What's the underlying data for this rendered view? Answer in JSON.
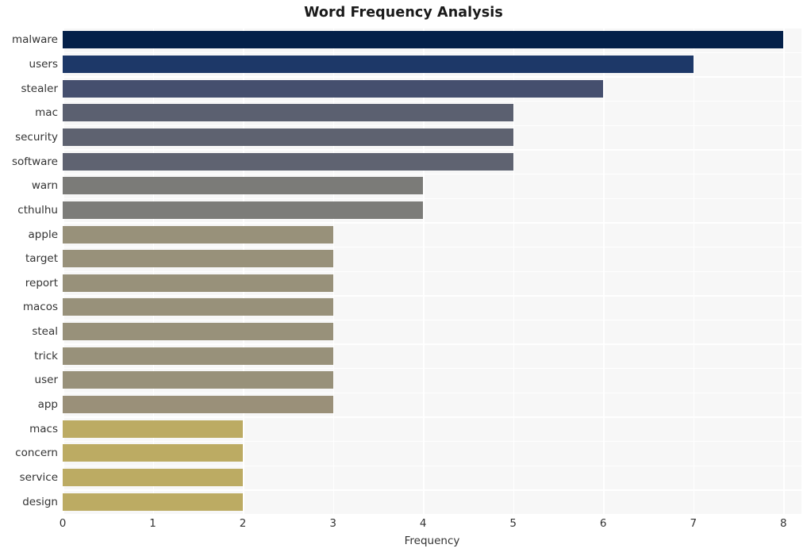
{
  "chart_data": {
    "type": "bar",
    "orientation": "horizontal",
    "title": "Word Frequency Analysis",
    "xlabel": "Frequency",
    "ylabel": "",
    "xlim": [
      0,
      8.2
    ],
    "xticks": [
      "0",
      "1",
      "2",
      "3",
      "4",
      "5",
      "6",
      "7",
      "8"
    ],
    "xtick_values": [
      0,
      1,
      2,
      3,
      4,
      5,
      6,
      7,
      8
    ],
    "grid": true,
    "legend": null,
    "categories": [
      "malware",
      "users",
      "stealer",
      "mac",
      "security",
      "software",
      "warn",
      "cthulhu",
      "apple",
      "target",
      "report",
      "macos",
      "steal",
      "trick",
      "user",
      "app",
      "macs",
      "concern",
      "service",
      "design"
    ],
    "values": [
      8,
      7,
      6,
      5,
      5,
      5,
      4,
      4,
      3,
      3,
      3,
      3,
      3,
      3,
      3,
      3,
      2,
      2,
      2,
      2
    ],
    "bar_colors": [
      "#042049",
      "#1d3868",
      "#454f6e",
      "#5b6070",
      "#5e6270",
      "#5f6371",
      "#7b7b78",
      "#7c7c79",
      "#98917a",
      "#98917a",
      "#98917a",
      "#98917a",
      "#98917a",
      "#98917a",
      "#98917a",
      "#9a9079",
      "#bcab63",
      "#bcab63",
      "#bcab63",
      "#bcab63"
    ],
    "plot_background": "#f7f7f7",
    "grid_color": "#ffffff",
    "figure_background": "#ffffff",
    "text_color": "#333333",
    "title_color": "#1a1a1a"
  }
}
